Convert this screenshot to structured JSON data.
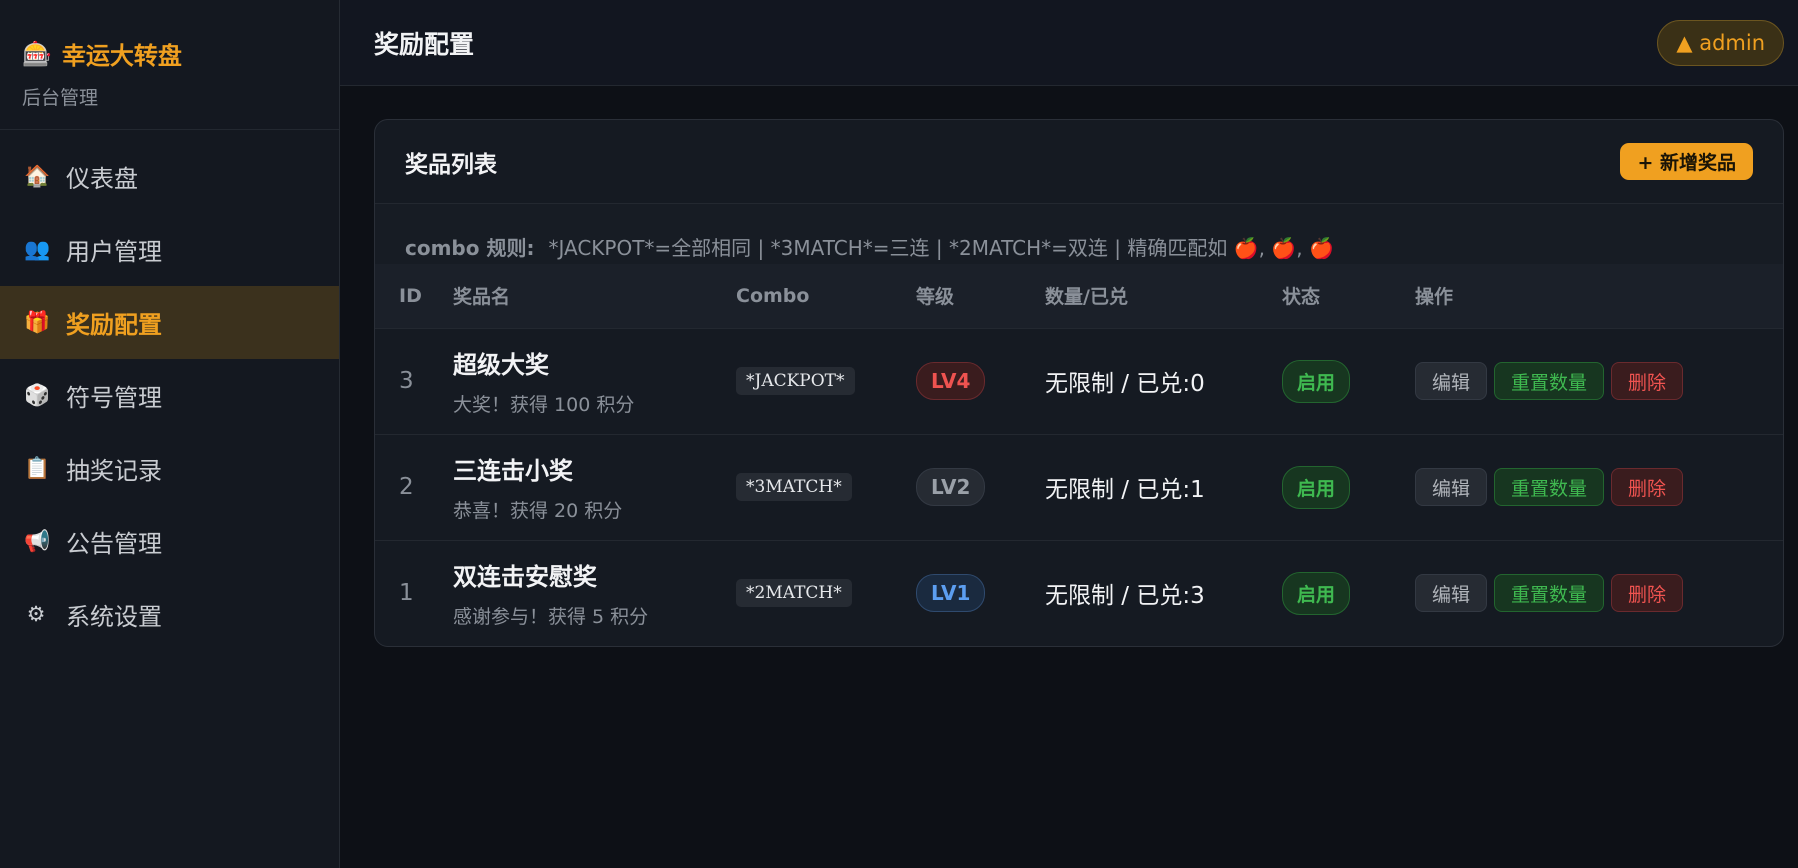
{
  "brand": {
    "icon": "slot-machine-icon",
    "name": "幸运大转盘",
    "subtitle": "后台管理"
  },
  "sidebar": {
    "items": [
      {
        "icon": "🏠",
        "icon_name": "house-icon",
        "label": "仪表盘",
        "active": false
      },
      {
        "icon": "👥",
        "icon_name": "users-icon",
        "label": "用户管理",
        "active": false
      },
      {
        "icon": "🎁",
        "icon_name": "gift-icon",
        "label": "奖励配置",
        "active": true
      },
      {
        "icon": "🎲",
        "icon_name": "dice-icon",
        "label": "符号管理",
        "active": false
      },
      {
        "icon": "📋",
        "icon_name": "clipboard-icon",
        "label": "抽奖记录",
        "active": false
      },
      {
        "icon": "📢",
        "icon_name": "megaphone-icon",
        "label": "公告管理",
        "active": false
      },
      {
        "icon": "⚙",
        "icon_name": "gear-icon",
        "label": "系统设置",
        "active": false
      }
    ]
  },
  "header": {
    "title": "奖励配置",
    "user_label": "▲ admin"
  },
  "card": {
    "title": "奖品列表",
    "add_button": "+ 新增奖品",
    "rules_label": "combo 规则:",
    "rules_text": "*JACKPOT*=全部相同 | *3MATCH*=三连 | *2MATCH*=双连 | 精确匹配如 🍎, 🍎, 🍎"
  },
  "table": {
    "headers": [
      "ID",
      "奖品名",
      "Combo",
      "等级",
      "数量/已兑",
      "状态",
      "操作"
    ],
    "rows": [
      {
        "id": "3",
        "name": "超级大奖",
        "desc": "大奖！获得 100 积分",
        "combo": "*JACKPOT*",
        "level": "LV4",
        "level_color": "#ef5350",
        "qty": "无限制 / 已兑:0",
        "status": "启用",
        "ops": [
          "编辑",
          "重置数量",
          "删除"
        ]
      },
      {
        "id": "2",
        "name": "三连击小奖",
        "desc": "恭喜！获得 20 积分",
        "combo": "*3MATCH*",
        "level": "LV2",
        "level_color": "#9aa0a8",
        "qty": "无限制 / 已兑:1",
        "status": "启用",
        "ops": [
          "编辑",
          "重置数量",
          "删除"
        ]
      },
      {
        "id": "1",
        "name": "双连击安慰奖",
        "desc": "感谢参与！获得 5 积分",
        "combo": "*2MATCH*",
        "level": "LV1",
        "level_color": "#5c9ef0",
        "qty": "无限制 / 已兑:3",
        "status": "启用",
        "ops": [
          "编辑",
          "重置数量",
          "删除"
        ]
      }
    ]
  },
  "colors": {
    "accent": "#f0a020",
    "background": "#0d1016",
    "sidebar": "#141820",
    "active_item": "#3b311d",
    "success": "#3fb950",
    "danger": "#ef5350"
  }
}
